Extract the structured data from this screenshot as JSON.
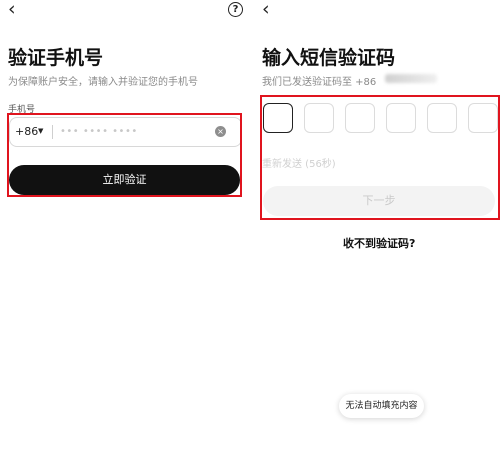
{
  "left": {
    "back_icon": "back-arrow-icon",
    "help_icon": "help-icon",
    "help_glyph": "?",
    "title": "验证手机号",
    "subtitle": "为保障账户安全，请输入并验证您的手机号",
    "phone_label": "手机号",
    "country_code": "+86",
    "country_arrow": "▼",
    "phone_value": "•••  ••••  ••••",
    "clear_glyph": "×",
    "verify_button": "立即验证"
  },
  "right": {
    "back_icon": "back-arrow-icon",
    "help_icon": "help-icon",
    "help_glyph": "?",
    "title": "输入短信验证码",
    "subtitle": "我们已发送验证码至 +86",
    "code_boxes": [
      "",
      "",
      "",
      "",
      "",
      ""
    ],
    "resend": "重新发送 (56秒)",
    "next_button": "下一步",
    "no_code_link": "收不到验证码?",
    "toast": "无法自动填充内容"
  },
  "colors": {
    "highlight": "#e0141e",
    "primary_button": "#111111",
    "disabled_button": "#f3f3f3"
  }
}
